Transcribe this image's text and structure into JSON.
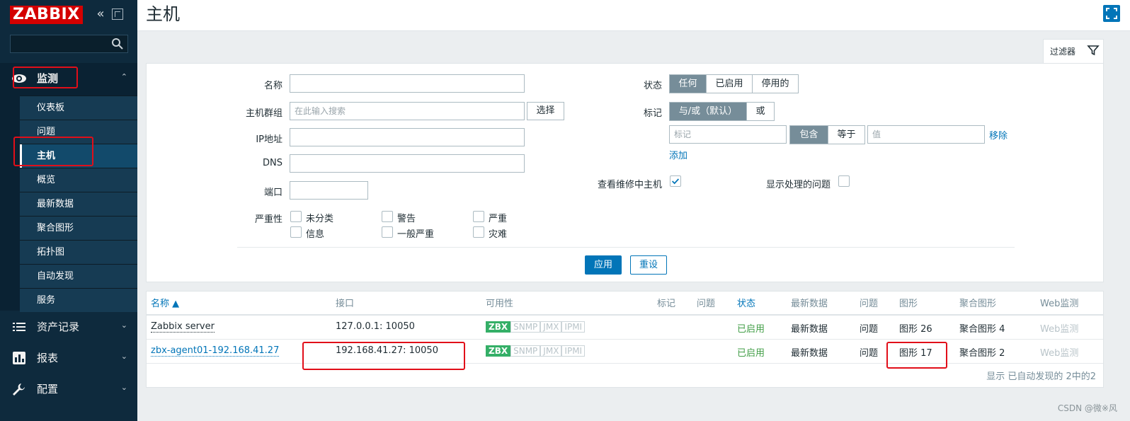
{
  "app": {
    "logo": "ZABBIX",
    "collapse_icon": "«",
    "page_title": "主机"
  },
  "sidebar": {
    "search_placeholder": "",
    "sections": [
      {
        "label": "监测",
        "icon": "eye-icon",
        "expanded": true
      },
      {
        "label": "资产记录",
        "icon": "list-icon"
      },
      {
        "label": "报表",
        "icon": "chart-icon"
      },
      {
        "label": "配置",
        "icon": "wrench-icon"
      }
    ],
    "submenu": [
      "仪表板",
      "问题",
      "主机",
      "概览",
      "最新数据",
      "聚合图形",
      "拓扑图",
      "自动发现",
      "服务"
    ],
    "active_submenu": "主机"
  },
  "filter": {
    "tab_label": "过滤器",
    "name_label": "名称",
    "name_value": "",
    "hostgroup_label": "主机群组",
    "hostgroup_placeholder": "在此输入搜索",
    "select_button": "选择",
    "ip_label": "IP地址",
    "dns_label": "DNS",
    "port_label": "端口",
    "severity_label": "严重性",
    "severities": [
      "未分类",
      "警告",
      "严重",
      "信息",
      "一般严重",
      "灾难"
    ],
    "status_label": "状态",
    "status_options": [
      "任何",
      "已启用",
      "停用的"
    ],
    "status_selected": "任何",
    "tags_label": "标记",
    "tag_logic_options": [
      "与/或（默认）",
      "或"
    ],
    "tag_placeholder": "标记",
    "tag_operator_options": [
      "包含",
      "等于"
    ],
    "value_placeholder": "值",
    "remove_link": "移除",
    "add_link": "添加",
    "maintenance_label": "查看维修中主机",
    "maintenance_checked": true,
    "suppressed_label": "显示处理的问题",
    "apply_button": "应用",
    "reset_button": "重设"
  },
  "table": {
    "headers": [
      "名称 ▲",
      "接口",
      "可用性",
      "标记",
      "问题",
      "状态",
      "最新数据",
      "问题",
      "图形",
      "聚合图形",
      "Web监测"
    ],
    "rows": [
      {
        "name": "Zabbix server",
        "interface": "127.0.0.1: 10050",
        "availability": [
          "ZBX",
          "SNMP",
          "JMX",
          "IPMI"
        ],
        "status": "已启用",
        "latest": "最新数据",
        "problems": "问题",
        "graphs": "图形 26",
        "screens": "聚合图形 4",
        "web": "Web监测"
      },
      {
        "name": "zbx-agent01-192.168.41.27",
        "interface": "192.168.41.27: 10050",
        "availability": [
          "ZBX",
          "SNMP",
          "JMX",
          "IPMI"
        ],
        "status": "已启用",
        "latest": "最新数据",
        "problems": "问题",
        "graphs": "图形 17",
        "screens": "聚合图形 2",
        "web": "Web监测"
      }
    ],
    "footer": "显示 已自动发现的 2中的2"
  },
  "watermark": "CSDN @微※风",
  "colors": {
    "sidebar_bg": "#0e2a3d",
    "accent": "#0275b8",
    "logo_red": "#d40000",
    "enabled_green": "#429e47",
    "zbx_green": "#34af67",
    "highlight_red": "#e10e19"
  }
}
